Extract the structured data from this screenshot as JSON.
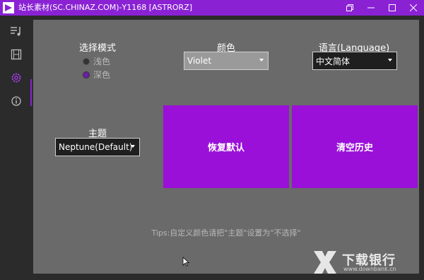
{
  "window": {
    "title": "站长素材(SC.CHINAZ.COM)-Y1168 [ASTRORZ]",
    "accent": "#8a22d4"
  },
  "sidebar": {
    "items": [
      {
        "icon": "playlist-icon"
      },
      {
        "icon": "film-icon"
      },
      {
        "icon": "gear-icon",
        "active": true
      },
      {
        "icon": "info-icon"
      }
    ]
  },
  "settings": {
    "mode_heading": "选择模式",
    "mode_options": [
      {
        "label": "浅色",
        "selected": false
      },
      {
        "label": "深色",
        "selected": true
      }
    ],
    "color_heading": "颜色",
    "color_value": "Violet",
    "language_heading": "语言(Language)",
    "language_value": "中文简体",
    "theme_heading": "主题",
    "theme_value": "Neptune(Default)",
    "restore_button": "恢复默认",
    "clear_button": "清空历史",
    "tips": "Tips:自定义颜色请把\"主题\"设置为\"不选择\"",
    "button_color": "#9a10d9"
  },
  "watermark": {
    "text": "下载银行",
    "url": "www.downbank.cn"
  }
}
